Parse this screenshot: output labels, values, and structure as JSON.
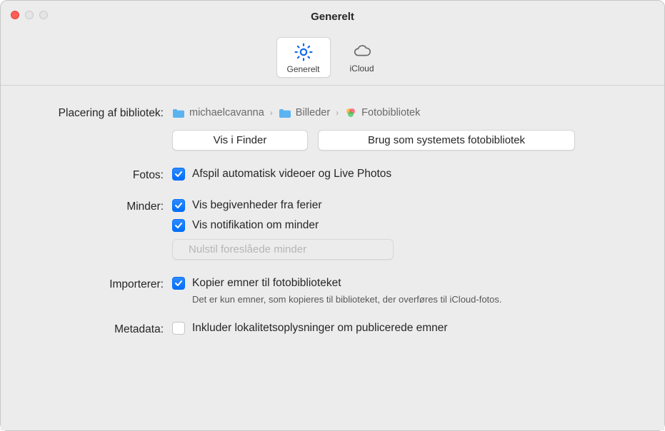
{
  "window": {
    "title": "Generelt"
  },
  "toolbar": {
    "tabs": [
      {
        "id": "generelt",
        "label": "Generelt",
        "selected": true
      },
      {
        "id": "icloud",
        "label": "iCloud",
        "selected": false
      }
    ]
  },
  "sections": {
    "library_location": {
      "label": "Placering af bibliotek:",
      "breadcrumb": {
        "parts": [
          "michaelcavanna",
          "Billeder",
          "Fotobibliotek"
        ]
      },
      "buttons": {
        "show_in_finder": "Vis i Finder",
        "use_as_system": "Brug som systemets fotobibliotek"
      }
    },
    "fotos": {
      "label": "Fotos:",
      "autoplay": {
        "checked": true,
        "text": "Afspil automatisk videoer og Live Photos"
      }
    },
    "minder": {
      "label": "Minder:",
      "holidays": {
        "checked": true,
        "text": "Vis begivenheder fra ferier"
      },
      "notification": {
        "checked": true,
        "text": "Vis notifikation om minder"
      },
      "reset_button": "Nulstil foreslåede minder"
    },
    "importerer": {
      "label": "Importerer:",
      "copy": {
        "checked": true,
        "text": "Kopier emner til fotobiblioteket",
        "help": "Det er kun emner, som kopieres til biblioteket, der overføres til iCloud-fotos."
      }
    },
    "metadata": {
      "label": "Metadata:",
      "location": {
        "checked": false,
        "text": "Inkluder lokalitetsoplysninger om publicerede emner"
      }
    }
  }
}
